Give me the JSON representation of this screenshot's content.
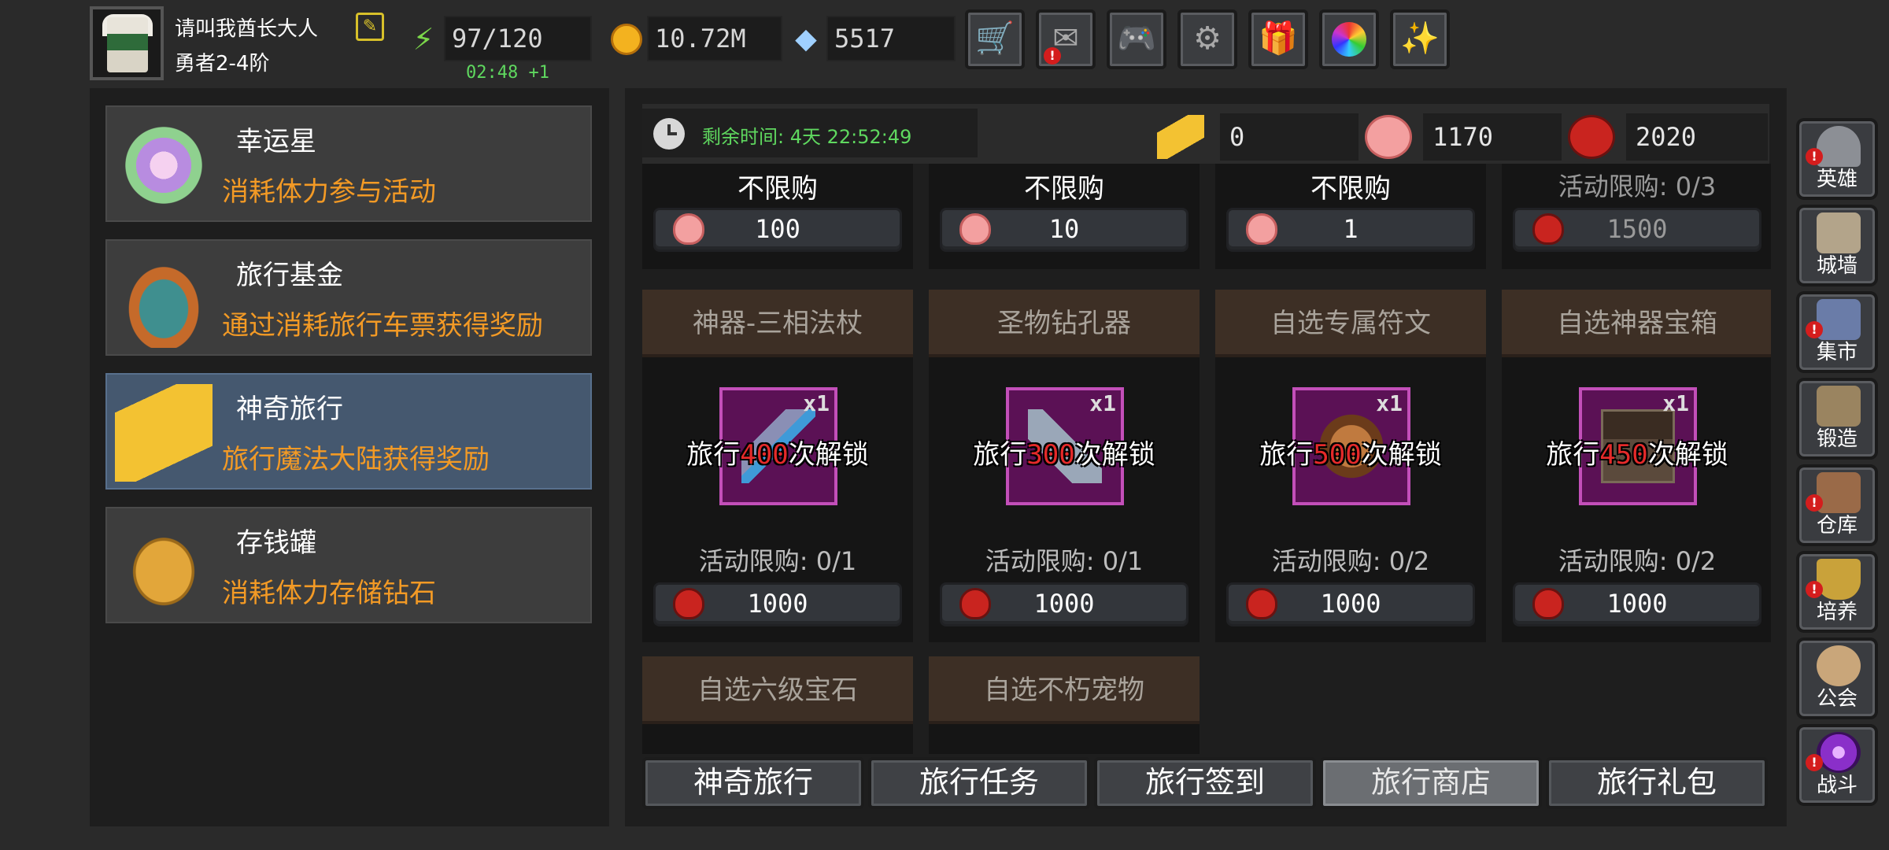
{
  "player": {
    "name": "请叫我酋长大人",
    "rank": "勇者2-4阶",
    "energy": "97/120",
    "energy_timer": "02:48 +1",
    "gold": "10.72M",
    "gems": "5517"
  },
  "top_buttons": [
    "cart-icon",
    "mail-icon",
    "gamepad-icon",
    "gear-icon",
    "gift-icon",
    "color-wheel-icon",
    "fireworks-icon"
  ],
  "left_menu": [
    {
      "title": "幸运星",
      "desc": "消耗体力参与活动",
      "icon": "lucky-star-icon",
      "active": false
    },
    {
      "title": "旅行基金",
      "desc": "通过消耗旅行车票获得奖励",
      "icon": "travel-fund-icon",
      "active": false
    },
    {
      "title": "神奇旅行",
      "desc": "旅行魔法大陆获得奖励",
      "icon": "travel-ticket-icon",
      "active": true
    },
    {
      "title": "存钱罐",
      "desc": "消耗体力存储钻石",
      "icon": "piggy-bank-icon",
      "active": false
    }
  ],
  "header": {
    "remaining": "剩余时间: 4天 22:52:49",
    "currencies": [
      {
        "icon": "ticket-icon",
        "value": "0"
      },
      {
        "icon": "pink-bag-icon",
        "value": "1170"
      },
      {
        "icon": "red-bag-icon",
        "value": "2020"
      }
    ]
  },
  "top_row": [
    {
      "limit": "不限购",
      "price": "100",
      "bag": "pink"
    },
    {
      "limit": "不限购",
      "price": "10",
      "bag": "pink"
    },
    {
      "limit": "不限购",
      "price": "1",
      "bag": "pink"
    },
    {
      "limit": "活动限购: 0/3",
      "price": "1500",
      "bag": "red"
    }
  ],
  "items": [
    {
      "name": "神器-三相法杖",
      "count": "x1",
      "unlock_pre": "旅行",
      "unlock_num": "400",
      "unlock_post": "次解锁",
      "limit": "活动限购: 0/1",
      "price": "1000",
      "art_color": "#8a8fb5"
    },
    {
      "name": "圣物钻孔器",
      "count": "x1",
      "unlock_pre": "旅行",
      "unlock_num": "300",
      "unlock_post": "次解锁",
      "limit": "活动限购: 0/1",
      "price": "1000",
      "art_color": "#9aa7b8"
    },
    {
      "name": "自选专属符文",
      "count": "x1",
      "unlock_pre": "旅行",
      "unlock_num": "500",
      "unlock_post": "次解锁",
      "limit": "活动限购: 0/2",
      "price": "1000",
      "art_color": "#a0653a"
    },
    {
      "name": "自选神器宝箱",
      "count": "x1",
      "unlock_pre": "旅行",
      "unlock_num": "450",
      "unlock_post": "次解锁",
      "limit": "活动限购: 0/2",
      "price": "1000",
      "art_color": "#5b4a3c"
    }
  ],
  "bottom_items": [
    {
      "name": "自选六级宝石"
    },
    {
      "name": "自选不朽宠物"
    }
  ],
  "tabs": [
    {
      "label": "神奇旅行",
      "active": false
    },
    {
      "label": "旅行任务",
      "active": false
    },
    {
      "label": "旅行签到",
      "active": false
    },
    {
      "label": "旅行商店",
      "active": true
    },
    {
      "label": "旅行礼包",
      "active": false
    }
  ],
  "right_nav": [
    {
      "label": "英雄",
      "icon": "helmet-icon",
      "alert": true,
      "color": "#8c8f95"
    },
    {
      "label": "城墙",
      "icon": "castle-wall-icon",
      "alert": false,
      "color": "#b3a48a"
    },
    {
      "label": "集市",
      "icon": "market-icon",
      "alert": true,
      "color": "#6a7ca8"
    },
    {
      "label": "锻造",
      "icon": "anvil-icon",
      "alert": false,
      "color": "#9a8460"
    },
    {
      "label": "仓库",
      "icon": "warehouse-icon",
      "alert": true,
      "color": "#9a6a48"
    },
    {
      "label": "培养",
      "icon": "trophy-icon",
      "alert": true,
      "color": "#c9a23a"
    },
    {
      "label": "公会",
      "icon": "guild-icon",
      "alert": false,
      "color": "#c9a67a"
    },
    {
      "label": "战斗",
      "icon": "portal-icon",
      "alert": true,
      "color": "#8a2fc9"
    }
  ],
  "alert_mark": "!",
  "colors": {
    "accent_orange": "#f39a25",
    "timer_green": "#5fd85f",
    "unlock_red": "#e52a2a",
    "active_menu": "#45586f"
  }
}
